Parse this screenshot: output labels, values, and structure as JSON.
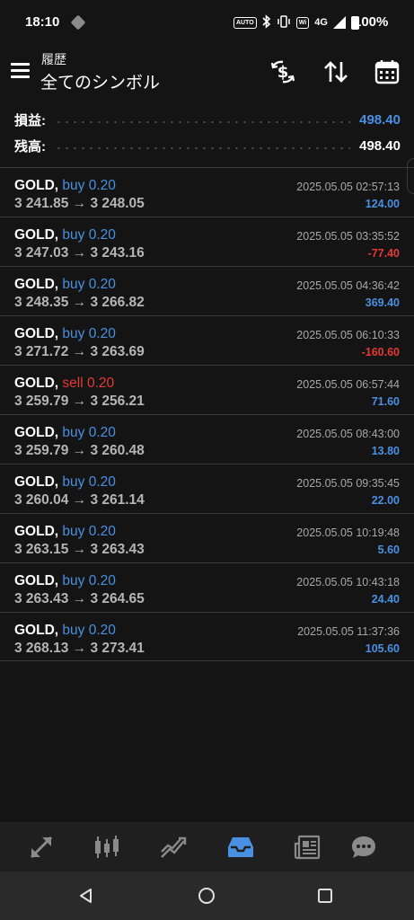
{
  "status_bar": {
    "time": "18:10",
    "auto_label": "AUTO",
    "wifi_label": "Wi",
    "network": "4G",
    "battery": "100%"
  },
  "header": {
    "subtitle": "履歴",
    "title": "全てのシンボル",
    "icons": [
      "menu-icon",
      "deposit-withdraw-icon",
      "sort-icon",
      "calendar-icon"
    ]
  },
  "summary": {
    "profit_label": "損益:",
    "profit_value": "498.40",
    "balance_label": "残高:",
    "balance_value": "498.40",
    "colors": {
      "profit": "#4a90e2",
      "balance": "#ffffff"
    }
  },
  "trades": [
    {
      "symbol": "GOLD,",
      "side": "buy 0.20",
      "prices": "3 241.85 → 3 248.05",
      "time": "2025.05.05 02:57:13",
      "profit": "124.00"
    },
    {
      "symbol": "GOLD,",
      "side": "buy 0.20",
      "prices": "3 247.03 → 3 243.16",
      "time": "2025.05.05 03:35:52",
      "profit": "-77.40"
    },
    {
      "symbol": "GOLD,",
      "side": "buy 0.20",
      "prices": "3 248.35 → 3 266.82",
      "time": "2025.05.05 04:36:42",
      "profit": "369.40"
    },
    {
      "symbol": "GOLD,",
      "side": "buy 0.20",
      "prices": "3 271.72 → 3 263.69",
      "time": "2025.05.05 06:10:33",
      "profit": "-160.60"
    },
    {
      "symbol": "GOLD,",
      "side": "sell 0.20",
      "prices": "3 259.79 → 3 256.21",
      "time": "2025.05.05 06:57:44",
      "profit": "71.60"
    },
    {
      "symbol": "GOLD,",
      "side": "buy 0.20",
      "prices": "3 259.79 → 3 260.48",
      "time": "2025.05.05 08:43:00",
      "profit": "13.80"
    },
    {
      "symbol": "GOLD,",
      "side": "buy 0.20",
      "prices": "3 260.04 → 3 261.14",
      "time": "2025.05.05 09:35:45",
      "profit": "22.00"
    },
    {
      "symbol": "GOLD,",
      "side": "buy 0.20",
      "prices": "3 263.15 → 3 263.43",
      "time": "2025.05.05 10:19:48",
      "profit": "5.60"
    },
    {
      "symbol": "GOLD,",
      "side": "buy 0.20",
      "prices": "3 263.43 → 3 264.65",
      "time": "2025.05.05 10:43:18",
      "profit": "24.40"
    },
    {
      "symbol": "GOLD,",
      "side": "buy 0.20",
      "prices": "3 268.13 → 3 273.41",
      "time": "2025.05.05 11:37:36",
      "profit": "105.60"
    }
  ],
  "bottom_nav": {
    "items": [
      "quotes-icon",
      "chart-icon",
      "trade-icon",
      "history-icon",
      "news-icon",
      "chat-icon"
    ],
    "active": "history-icon",
    "active_color": "#4a90e2"
  },
  "system_nav": [
    "back-icon",
    "home-icon",
    "recents-icon"
  ]
}
